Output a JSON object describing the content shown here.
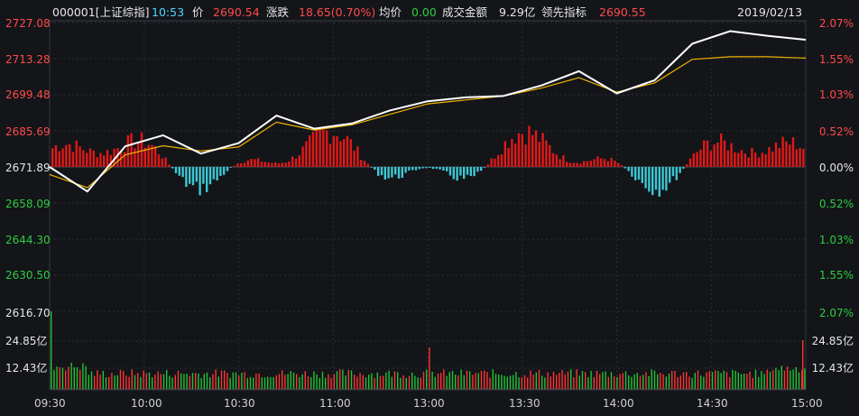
{
  "header": {
    "code": "000001[上证综指]",
    "time": "10:53",
    "price_label": "价",
    "price_value": "2690.54",
    "change_label": "涨跌",
    "change_value": "18.65(0.70%)",
    "avg_label": "均价",
    "avg_value": "0.00",
    "volume_label": "成交金额",
    "volume_value": "9.29亿",
    "leading_label": "领先指标",
    "leading_value": "2690.55",
    "date": "2019/02/13"
  },
  "price_axis": {
    "left": [
      "2727.08",
      "2713.28",
      "2699.48",
      "2685.69",
      "2671.89",
      "2658.09",
      "2644.30",
      "2630.50",
      "2616.70"
    ],
    "right": [
      "2.07%",
      "1.55%",
      "1.03%",
      "0.52%",
      "0.00%",
      "0.52%",
      "1.03%",
      "1.55%",
      "2.07%"
    ]
  },
  "volume_axis": {
    "left": [
      "24.85亿",
      "12.43亿"
    ],
    "right": [
      "24.85亿",
      "12.43亿"
    ]
  },
  "time_axis": [
    "09:30",
    "10:00",
    "10:30",
    "11:00",
    "13:00",
    "13:30",
    "14:00",
    "14:30",
    "15:00"
  ],
  "colors": {
    "up": "#e01818",
    "down": "#3cc8d4",
    "price_line": "#ffffff",
    "avg_line": "#f0b400",
    "grid": "#2b2e36",
    "vol_up": "#ff3333",
    "vol_down": "#22c233"
  },
  "chart_data": {
    "type": "line",
    "prev_close": 2671.89,
    "ylim": [
      2616.7,
      2727.08
    ],
    "x": [
      "09:30",
      "09:45",
      "10:00",
      "10:10",
      "10:20",
      "10:30",
      "10:45",
      "11:00",
      "11:15",
      "11:30",
      "13:00",
      "13:15",
      "13:30",
      "13:45",
      "14:00",
      "14:10",
      "14:20",
      "14:30",
      "14:40",
      "14:50",
      "15:00"
    ],
    "series": [
      {
        "values": [
          2671.89,
          2662.5,
          2679.8,
          2684.0,
          2677.0,
          2681.0,
          2691.5,
          2686.5,
          2688.5,
          2693.5,
          2697.0,
          2698.5,
          2699.0,
          2703.0,
          2708.5,
          2700.0,
          2705.0,
          2719.0,
          2723.8,
          2722.0,
          2720.5
        ]
      },
      {
        "values": [
          2669.0,
          2664.0,
          2676.5,
          2680.0,
          2678.0,
          2679.5,
          2689.0,
          2686.0,
          2688.0,
          2692.0,
          2696.0,
          2697.5,
          2699.0,
          2702.0,
          2706.0,
          2700.5,
          2704.0,
          2713.0,
          2714.0,
          2714.0,
          2713.5
        ]
      }
    ]
  }
}
